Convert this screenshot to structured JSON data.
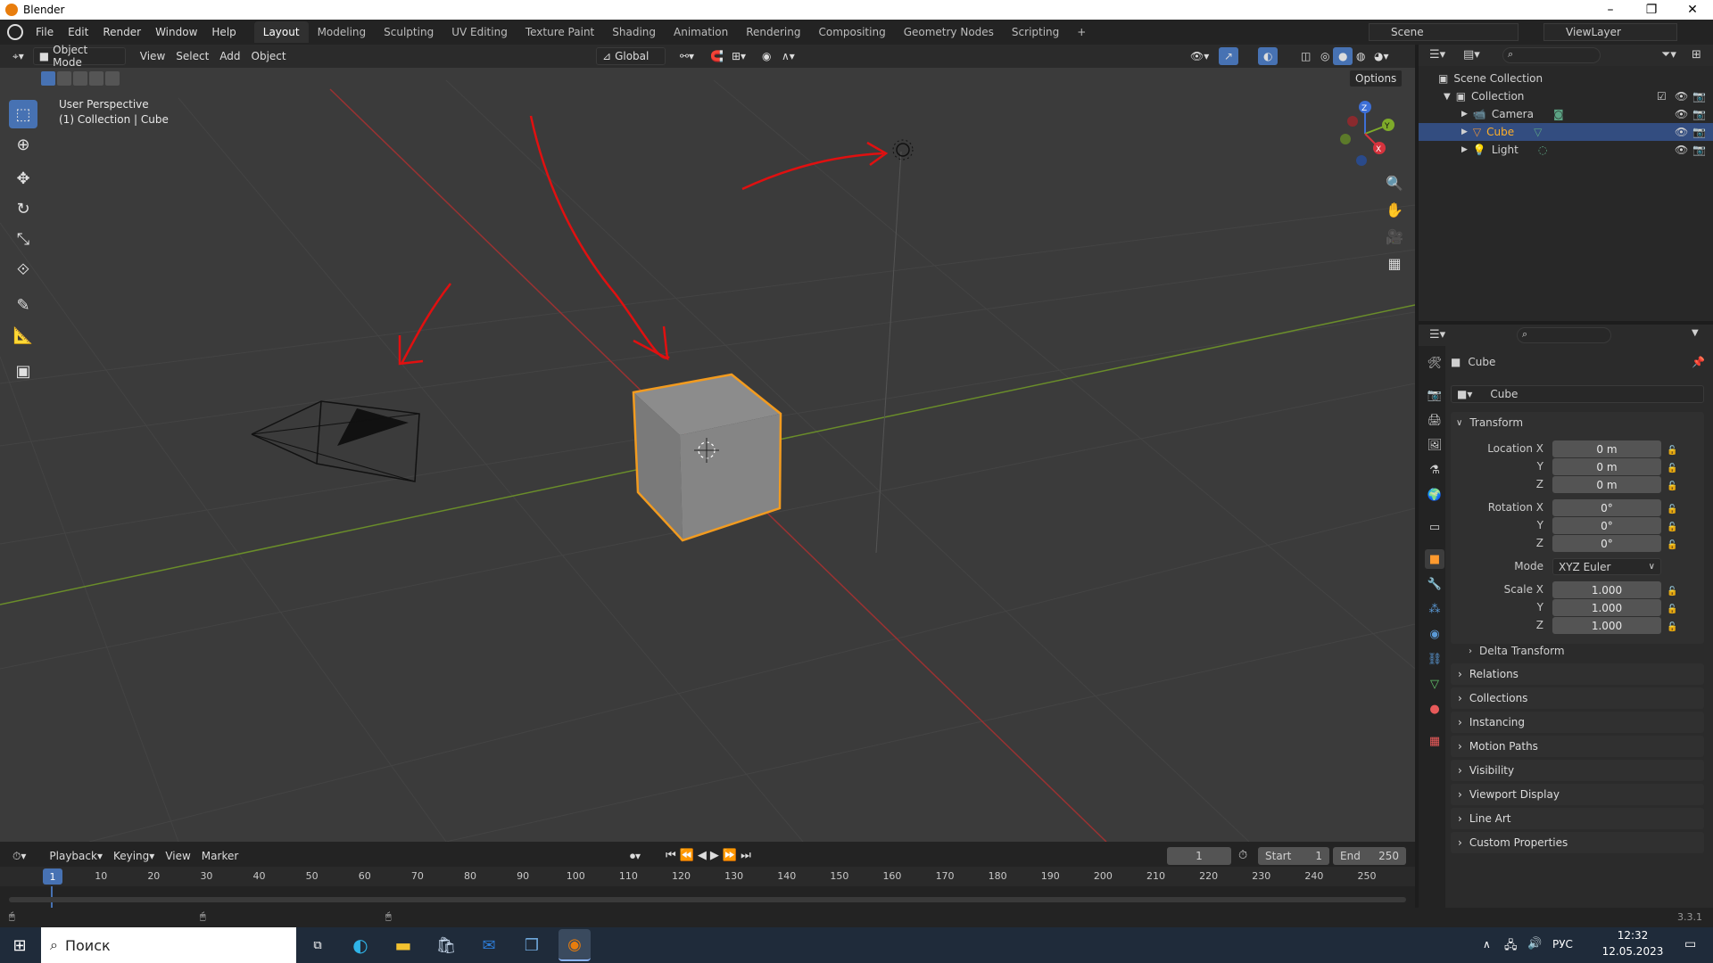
{
  "window": {
    "title": "Blender"
  },
  "menubar": {
    "menus": [
      "File",
      "Edit",
      "Render",
      "Window",
      "Help"
    ],
    "workspaces": [
      "Layout",
      "Modeling",
      "Sculpting",
      "UV Editing",
      "Texture Paint",
      "Shading",
      "Animation",
      "Rendering",
      "Compositing",
      "Geometry Nodes",
      "Scripting"
    ],
    "active_workspace": "Layout",
    "add_workspace": "+",
    "scene": "Scene",
    "viewlayer": "ViewLayer"
  },
  "viewport": {
    "mode": "Object Mode",
    "menus": [
      "View",
      "Select",
      "Add",
      "Object"
    ],
    "transform_orientation": "Global",
    "options": "Options",
    "overlay_line1": "User Perspective",
    "overlay_line2": "(1) Collection | Cube",
    "gizmo": {
      "x": "X",
      "y": "Y",
      "z": "Z"
    }
  },
  "outliner": {
    "root": "Scene Collection",
    "collection": "Collection",
    "items": [
      {
        "name": "Camera",
        "selected": false
      },
      {
        "name": "Cube",
        "selected": true
      },
      {
        "name": "Light",
        "selected": false
      }
    ]
  },
  "properties": {
    "object_name": "Cube",
    "data_name": "Cube",
    "transform_header": "Transform",
    "location": {
      "label": "Location X",
      "x": "0 m",
      "y": "0 m",
      "z": "0 m"
    },
    "rotation": {
      "label": "Rotation X",
      "x": "0°",
      "y": "0°",
      "z": "0°"
    },
    "mode_label": "Mode",
    "mode_value": "XYZ Euler",
    "scale": {
      "label": "Scale X",
      "x": "1.000",
      "y": "1.000",
      "z": "1.000"
    },
    "axis_y": "Y",
    "axis_z": "Z",
    "delta": "Delta Transform",
    "panels": [
      "Relations",
      "Collections",
      "Instancing",
      "Motion Paths",
      "Visibility",
      "Viewport Display",
      "Line Art",
      "Custom Properties"
    ]
  },
  "timeline": {
    "menus": [
      "Playback",
      "Keying",
      "View",
      "Marker"
    ],
    "current_frame": "1",
    "start_label": "Start",
    "start_value": "1",
    "end_label": "End",
    "end_value": "250",
    "ticks": [
      "10",
      "20",
      "30",
      "40",
      "50",
      "60",
      "70",
      "80",
      "90",
      "100",
      "110",
      "120",
      "130",
      "140",
      "150",
      "160",
      "170",
      "180",
      "190",
      "200",
      "210",
      "220",
      "230",
      "240",
      "250"
    ],
    "playhead": "1"
  },
  "status": {
    "version": "3.3.1"
  },
  "taskbar": {
    "search_placeholder": "Поиск",
    "language": "РУС",
    "time": "12:32",
    "date": "12.05.2023"
  }
}
